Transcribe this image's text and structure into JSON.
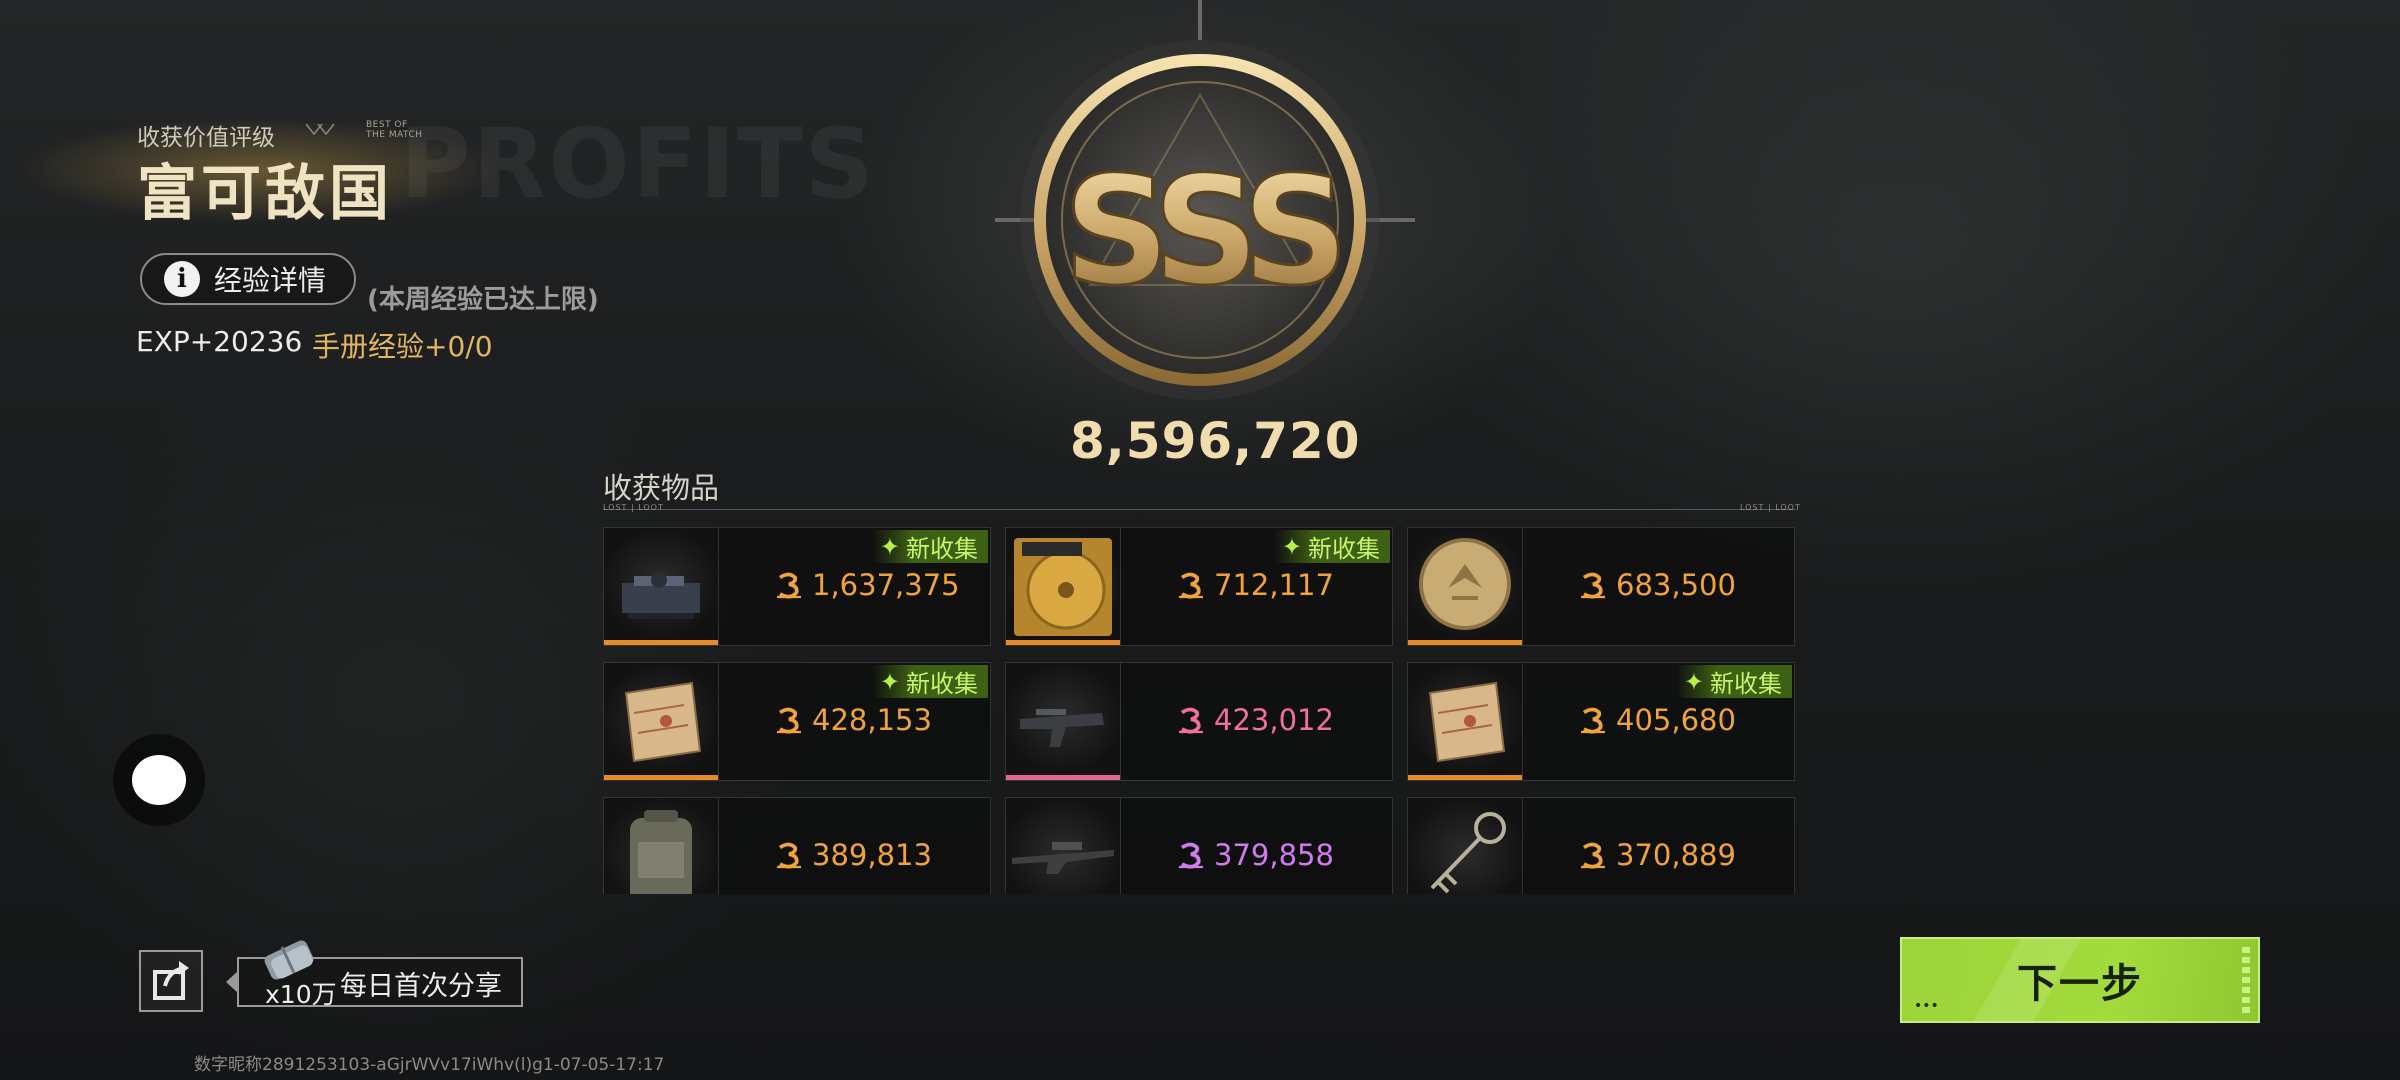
{
  "rating": {
    "label": "收获价值评级",
    "tag_line1": "BEST OF",
    "tag_line2": "THE MATCH",
    "title": "富可敌国",
    "bg_word": "PROFITS"
  },
  "experience": {
    "button_label": "经验详情",
    "weekly_note": "(本周经验已达上限)",
    "exp_text": "EXP+20236",
    "handbook_text": "手册经验+0/0"
  },
  "grade": {
    "text": "SSS",
    "total_value": "8,596,720"
  },
  "loot": {
    "title": "收获物品",
    "lost_left": "LOST | LOOT",
    "lost_right": "LOST | LOOT",
    "new_label": "新收集",
    "items": [
      {
        "value": "1,637,375",
        "value_color": "#f0a33a",
        "rarity_color": "#e8892a",
        "is_new": true,
        "icon": "turntable-icon"
      },
      {
        "value": "712,117",
        "value_color": "#f0a33a",
        "rarity_color": "#e8892a",
        "is_new": true,
        "icon": "gold-record-icon"
      },
      {
        "value": "683,500",
        "value_color": "#f0a33a",
        "rarity_color": "#e8892a",
        "is_new": false,
        "icon": "gold-medal-icon"
      },
      {
        "value": "428,153",
        "value_color": "#f0a33a",
        "rarity_color": "#e8892a",
        "is_new": true,
        "icon": "treasure-map-icon"
      },
      {
        "value": "423,012",
        "value_color": "#f0709a",
        "rarity_color": "#e5678f",
        "is_new": false,
        "icon": "smg-icon"
      },
      {
        "value": "405,680",
        "value_color": "#f0a33a",
        "rarity_color": "#e8892a",
        "is_new": true,
        "icon": "treasure-map-icon"
      },
      {
        "value": "389,813",
        "value_color": "#f0a33a",
        "rarity_color": "#e8892a",
        "is_new": false,
        "icon": "backpack-icon"
      },
      {
        "value": "379,858",
        "value_color": "#d27af0",
        "rarity_color": "#b45de0",
        "is_new": false,
        "icon": "sniper-rifle-icon"
      },
      {
        "value": "370,889",
        "value_color": "#f0a33a",
        "rarity_color": "#e8892a",
        "is_new": false,
        "icon": "key-icon"
      }
    ]
  },
  "share": {
    "reward": "x10万",
    "label": "每日首次分享"
  },
  "footer": {
    "text": "数字昵称2891253103-aGjrWVv17iWhv(l)g1-07-05-17:17"
  },
  "next_button": {
    "label": "下一步"
  },
  "colors": {
    "accent_green": "#9cd43a",
    "gold": "#f1dcae",
    "orange": "#f0a33a"
  }
}
